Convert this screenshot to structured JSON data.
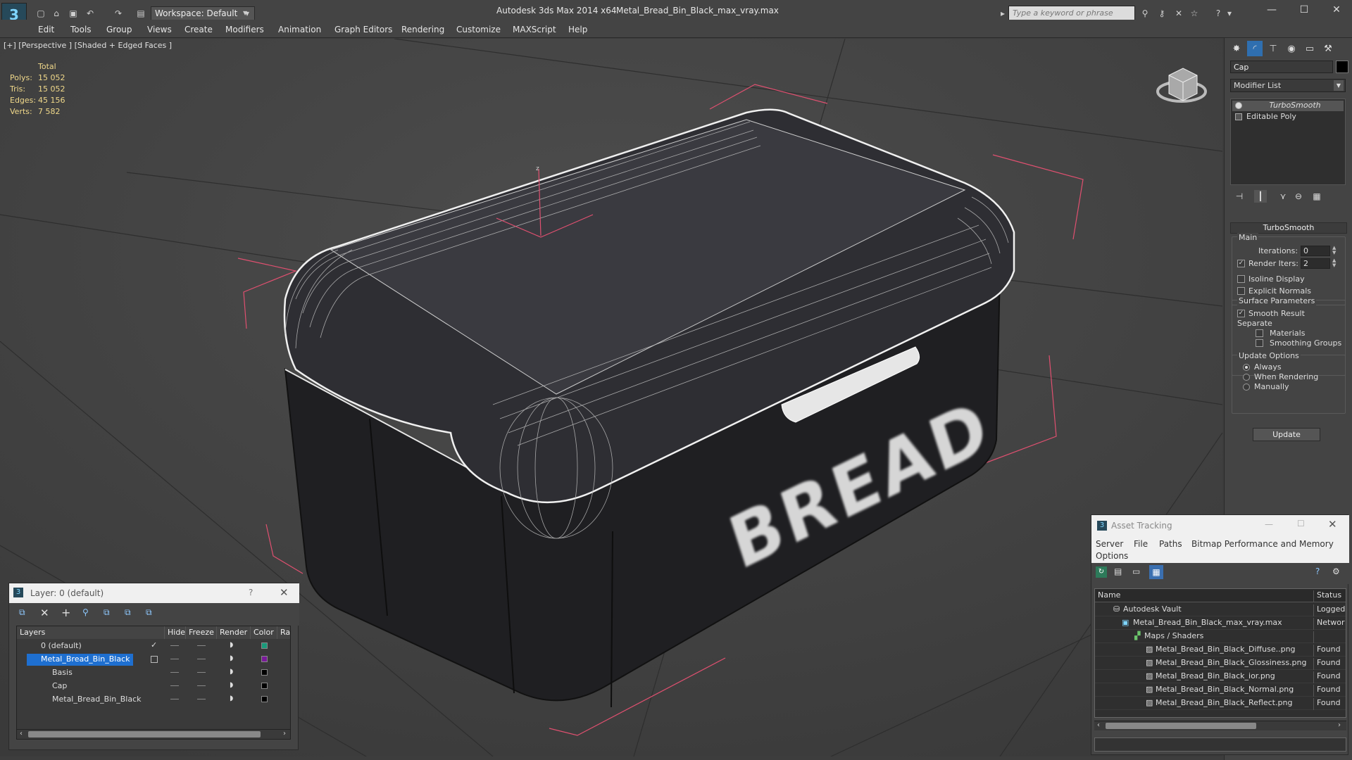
{
  "titlebar": {
    "workspace": "Workspace: Default",
    "app_name": "Autodesk 3ds Max  2014 x64",
    "file_name": "Metal_Bread_Bin_Black_max_vray.max",
    "search_placeholder": "Type a keyword or phrase"
  },
  "menu": [
    "Edit",
    "Tools",
    "Group",
    "Views",
    "Create",
    "Modifiers",
    "Animation",
    "Graph Editors",
    "Rendering",
    "Customize",
    "MAXScript",
    "Help"
  ],
  "viewport": {
    "label": "[+] [Perspective ] [Shaded + Edged Faces ]",
    "stats_header": "Total",
    "stats": [
      {
        "label": "Polys:",
        "value": "15 052"
      },
      {
        "label": "Tris:",
        "value": "15 052"
      },
      {
        "label": "Edges:",
        "value": "45 156"
      },
      {
        "label": "Verts:",
        "value": "7 582"
      }
    ],
    "model_text": "BREAD",
    "axis_label": "z"
  },
  "command_panel": {
    "object_name": "Cap",
    "modifier_list": "Modifier List",
    "stack": [
      "TurboSmooth",
      "Editable Poly"
    ],
    "turbosmooth": {
      "title": "TurboSmooth",
      "main": "Main",
      "iterations_label": "Iterations:",
      "iterations": "0",
      "render_iters_label": "Render Iters:",
      "render_iters": "2",
      "isoline": "Isoline Display",
      "explicit_normals": "Explicit Normals",
      "surface_params": "Surface Parameters",
      "smooth_result": "Smooth Result",
      "separate": "Separate",
      "materials": "Materials",
      "smoothing_groups": "Smoothing Groups",
      "update_options": "Update Options",
      "always": "Always",
      "when_rendering": "When Rendering",
      "manually": "Manually",
      "update": "Update"
    }
  },
  "layer_window": {
    "title": "Layer: 0 (default)",
    "help": "?",
    "columns": [
      "Layers",
      "Hide",
      "Freeze",
      "Render",
      "Color",
      "Ra"
    ],
    "rows": [
      {
        "name": "0 (default)",
        "color": "#1a9a7a",
        "active": true
      },
      {
        "name": "Metal_Bread_Bin_Black",
        "color": "#7a1a9a",
        "selected": true
      },
      {
        "name": "Basis",
        "color": "#000000"
      },
      {
        "name": "Cap",
        "color": "#000000"
      },
      {
        "name": "Metal_Bread_Bin_Black",
        "color": "#000000"
      }
    ]
  },
  "asset_tracking": {
    "title": "Asset Tracking",
    "menu": [
      "Server",
      "File",
      "Paths",
      "Bitmap Performance and Memory",
      "Options"
    ],
    "columns": [
      "Name",
      "Status"
    ],
    "rows": [
      {
        "name": "Autodesk Vault",
        "status": "Logged"
      },
      {
        "name": "Metal_Bread_Bin_Black_max_vray.max",
        "status": "Networ"
      },
      {
        "name": "Maps / Shaders",
        "status": ""
      },
      {
        "name": "Metal_Bread_Bin_Black_Diffuse..png",
        "status": "Found"
      },
      {
        "name": "Metal_Bread_Bin_Black_Glossiness.png",
        "status": "Found"
      },
      {
        "name": "Metal_Bread_Bin_Black_ior.png",
        "status": "Found"
      },
      {
        "name": "Metal_Bread_Bin_Black_Normal.png",
        "status": "Found"
      },
      {
        "name": "Metal_Bread_Bin_Black_Reflect.png",
        "status": "Found"
      }
    ]
  },
  "colors": {
    "accent_selection": "#1e6fd0",
    "stat_text": "#f0d88a",
    "bbox_bracket": "#e05070"
  }
}
